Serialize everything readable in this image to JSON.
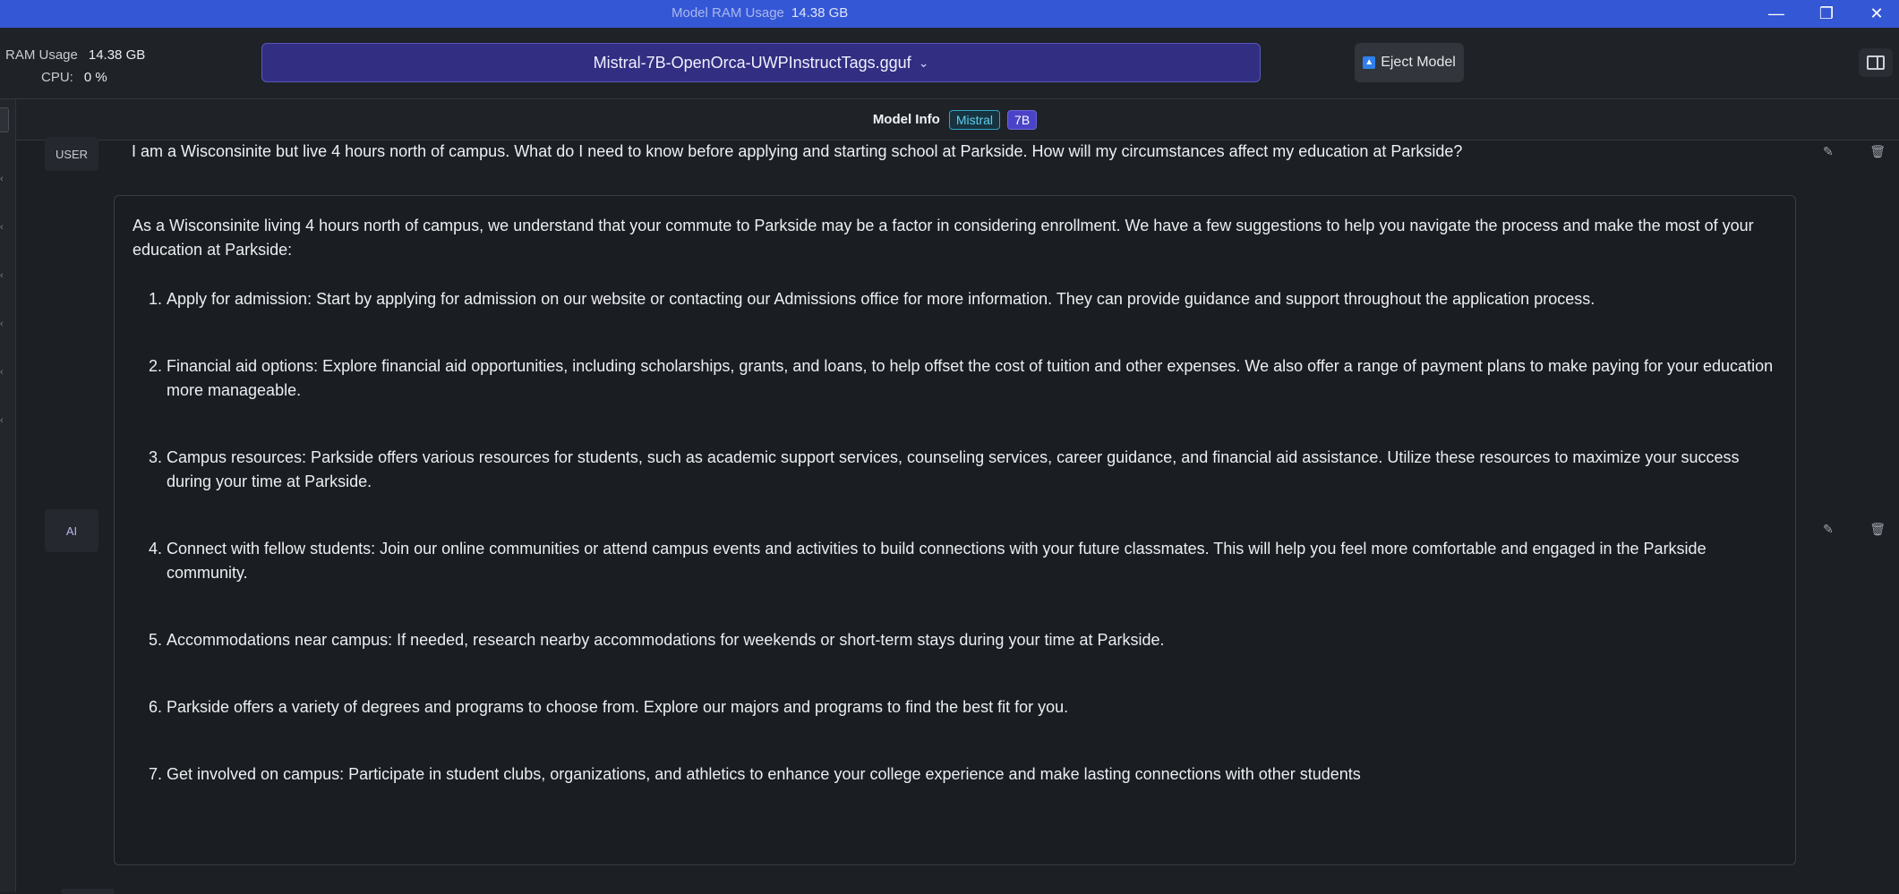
{
  "window": {
    "title_label": "Model RAM Usage",
    "title_value": "14.38 GB",
    "controls": {
      "minimize": "—",
      "maximize": "❐",
      "close": "✕"
    }
  },
  "toolbar": {
    "ram_label": "RAM Usage",
    "ram_value": "14.38 GB",
    "cpu_label": "CPU:",
    "cpu_value": "0 %",
    "model_name": "Mistral-7B-OpenOrca-UWPInstructTags.gguf",
    "eject_label": "Eject Model"
  },
  "model_info": {
    "label": "Model Info",
    "family_badge": "Mistral",
    "size_badge": "7B"
  },
  "chat": {
    "user_role": "USER",
    "ai_role": "AI",
    "user_message": "I am a Wisconsinite but live 4 hours north of campus. What do I need to know before applying and starting school at Parkside. How will my circumstances affect my education at Parkside?",
    "ai_intro": " As a Wisconsinite living 4 hours north of campus, we understand that your commute to Parkside may be a factor in considering enrollment. We have a few suggestions to help you navigate the process and make the most of your education at Parkside:",
    "ai_items": [
      "Apply for admission: Start by applying for admission on our website or contacting our Admissions office for more information. They can provide guidance and support throughout the application process.",
      "Financial aid options: Explore financial aid opportunities, including scholarships, grants, and loans, to help offset the cost of tuition and other expenses. We also offer a range of payment plans to make paying for your education more manageable.",
      "Campus resources: Parkside offers various resources for students, such as academic support services, counseling services, career guidance, and financial aid assistance. Utilize these resources to maximize your success during your time at Parkside.",
      "Connect with fellow students: Join our online communities or attend campus events and activities to build connections with your future classmates. This will help you feel more comfortable and engaged in the Parkside community.",
      "Accommodations near campus: If needed, research nearby accommodations for weekends or short-term stays during your time at Parkside.",
      "Parkside offers a variety of degrees and programs to choose from. Explore our majors and programs to find the best fit for you.",
      "Get involved on campus: Participate in student clubs, organizations, and athletics to enhance your college experience and make lasting connections with other students"
    ]
  }
}
